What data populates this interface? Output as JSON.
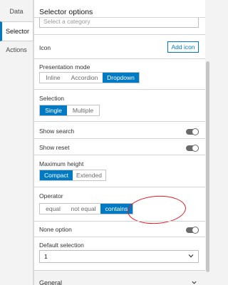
{
  "sidebar": {
    "tabs": [
      {
        "label": "Data"
      },
      {
        "label": "Selector"
      },
      {
        "label": "Actions"
      }
    ]
  },
  "panel": {
    "title": "Selector options",
    "category_placeholder": "Select a category",
    "icon": {
      "label": "Icon",
      "button": "Add icon"
    },
    "presentation_mode": {
      "label": "Presentation mode",
      "options": [
        "Inline",
        "Accordion",
        "Dropdown"
      ],
      "selected": "Dropdown"
    },
    "selection": {
      "label": "Selection",
      "options": [
        "Single",
        "Multiple"
      ],
      "selected": "Single"
    },
    "show_search": {
      "label": "Show search",
      "on": false
    },
    "show_reset": {
      "label": "Show reset",
      "on": false
    },
    "maximum_height": {
      "label": "Maximum height",
      "options": [
        "Compact",
        "Extended"
      ],
      "selected": "Compact"
    },
    "operator": {
      "label": "Operator",
      "options": [
        "equal",
        "not equal",
        "contains"
      ],
      "selected": "contains"
    },
    "none_option": {
      "label": "None option",
      "on": false
    },
    "default_selection": {
      "label": "Default selection",
      "value": "1"
    },
    "footer": {
      "label": "General"
    }
  },
  "colors": {
    "accent": "#007ac2",
    "annotation": "#e01b24"
  }
}
